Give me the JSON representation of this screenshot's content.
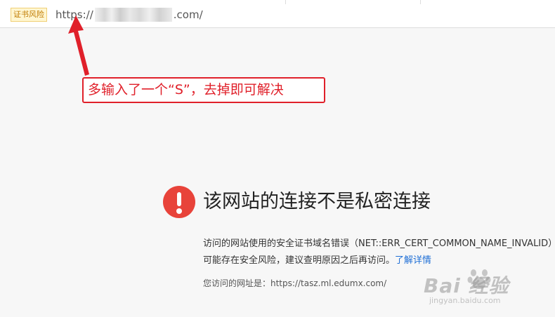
{
  "address_bar": {
    "cert_warning_label": "证书风险",
    "url_scheme": "https://",
    "url_suffix": ".com/"
  },
  "annotation": {
    "text": "多输入了一个“S”，去掉即可解决",
    "color": "#e0202a"
  },
  "error": {
    "icon": "exclamation-icon",
    "icon_color": "#e8433a",
    "title": "该网站的连接不是私密连接",
    "description_line1": "访问的网站使用的安全证书域名错误（NET::ERR_CERT_COMMON_NAME_INVALID）",
    "description_line2_prefix": "可能存在安全风险，建议查明原因之后再访问。",
    "learn_more_label": "了解详情",
    "link_color": "#1f6fd6",
    "visited_url_text": "您访问的网址是：https://tasz.ml.edumx.com/"
  },
  "watermark": {
    "brand": "Bai  经验",
    "site": "jingyan.baidu.com"
  }
}
